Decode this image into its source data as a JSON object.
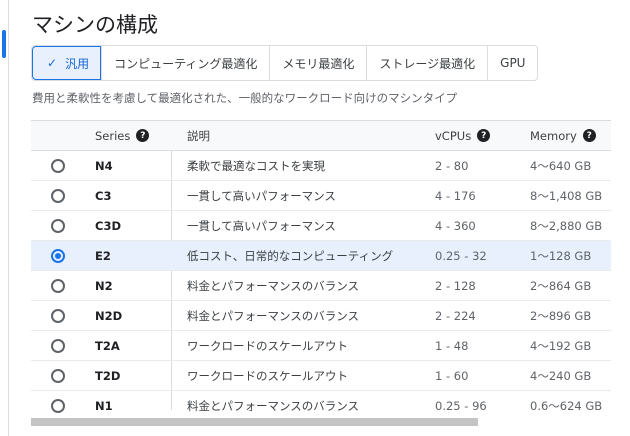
{
  "header": {
    "title": "マシンの構成"
  },
  "tabs": [
    {
      "label": "汎用",
      "selected": true
    },
    {
      "label": "コンピューティング最適化",
      "selected": false
    },
    {
      "label": "メモリ最適化",
      "selected": false
    },
    {
      "label": "ストレージ最適化",
      "selected": false
    },
    {
      "label": "GPU",
      "selected": false
    }
  ],
  "subtitle": "費用と柔軟性を考慮して最適化された、一般的なワークロード向けのマシンタイプ",
  "table": {
    "columns": {
      "series": "Series",
      "description": "説明",
      "vcpus": "vCPUs",
      "memory": "Memory"
    },
    "rows": [
      {
        "series": "N4",
        "description": "柔軟で最適なコストを実現",
        "vcpus": "2 - 80",
        "memory": "4～640 GB",
        "selected": false
      },
      {
        "series": "C3",
        "description": "一貫して高いパフォーマンス",
        "vcpus": "4 - 176",
        "memory": "8～1,408 GB",
        "selected": false
      },
      {
        "series": "C3D",
        "description": "一貫して高いパフォーマンス",
        "vcpus": "4 - 360",
        "memory": "8～2,880 GB",
        "selected": false
      },
      {
        "series": "E2",
        "description": "低コスト、日常的なコンピューティング",
        "vcpus": "0.25 - 32",
        "memory": "1～128 GB",
        "selected": true
      },
      {
        "series": "N2",
        "description": "料金とパフォーマンスのバランス",
        "vcpus": "2 - 128",
        "memory": "2～864 GB",
        "selected": false
      },
      {
        "series": "N2D",
        "description": "料金とパフォーマンスのバランス",
        "vcpus": "2 - 224",
        "memory": "2～896 GB",
        "selected": false
      },
      {
        "series": "T2A",
        "description": "ワークロードのスケールアウト",
        "vcpus": "1 - 48",
        "memory": "4～192 GB",
        "selected": false
      },
      {
        "series": "T2D",
        "description": "ワークロードのスケールアウト",
        "vcpus": "1 - 60",
        "memory": "4～240 GB",
        "selected": false
      },
      {
        "series": "N1",
        "description": "料金とパフォーマンスのバランス",
        "vcpus": "0.25 - 96",
        "memory": "0.6～624 GB",
        "selected": false
      }
    ]
  },
  "icons": {
    "check": "check-icon",
    "help": "help-icon",
    "radio": "radio-icon"
  },
  "colors": {
    "accent": "#1a73e8",
    "selected_bg": "#e8f0fe"
  }
}
